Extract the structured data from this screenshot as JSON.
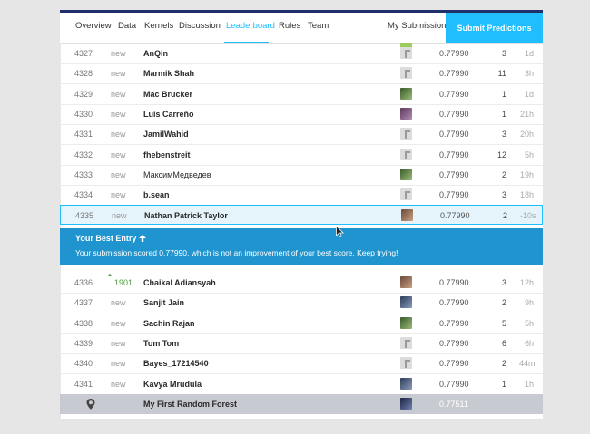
{
  "nav": {
    "tabs": [
      "Overview",
      "Data",
      "Kernels",
      "Discussion",
      "Leaderboard",
      "Rules",
      "Team"
    ],
    "my_submissions": "My Submissions",
    "submit": "Submit Predictions"
  },
  "rows_top": [
    {
      "rank": "4327",
      "change": "new",
      "team": "AnQin",
      "score": "0.77990",
      "entries": "3",
      "last": "1d",
      "avatar": "placeholder"
    },
    {
      "rank": "4328",
      "change": "new",
      "team": "Marmik Shah",
      "score": "0.77990",
      "entries": "11",
      "last": "3h",
      "avatar": "placeholder"
    },
    {
      "rank": "4329",
      "change": "new",
      "team": "Mac Brucker",
      "score": "0.77990",
      "entries": "1",
      "last": "1d",
      "avatar": "photo"
    },
    {
      "rank": "4330",
      "change": "new",
      "team": "Luis Carreño",
      "score": "0.77990",
      "entries": "1",
      "last": "21h",
      "avatar": "photo"
    },
    {
      "rank": "4331",
      "change": "new",
      "team": "JamilWahid",
      "score": "0.77990",
      "entries": "3",
      "last": "20h",
      "avatar": "placeholder"
    },
    {
      "rank": "4332",
      "change": "new",
      "team": "fhebenstreit",
      "score": "0.77990",
      "entries": "12",
      "last": "5h",
      "avatar": "placeholder"
    },
    {
      "rank": "4333",
      "change": "new",
      "team": "МаксимМедведев",
      "score": "0.77990",
      "entries": "2",
      "last": "19h",
      "avatar": "photo"
    },
    {
      "rank": "4334",
      "change": "new",
      "team": "b.sean",
      "score": "0.77990",
      "entries": "3",
      "last": "18h",
      "avatar": "placeholder"
    },
    {
      "rank": "4335",
      "change": "new",
      "team": "Nathan Patrick Taylor",
      "score": "0.77990",
      "entries": "2",
      "last": "-10s",
      "avatar": "photo"
    }
  ],
  "best_entry": {
    "title": "Your Best Entry",
    "message": "Your submission scored 0.77990, which is not an improvement of your best score. Keep trying!"
  },
  "rows_bottom": [
    {
      "rank": "4336",
      "change": "1901",
      "team": "Chaikal Adiansyah",
      "score": "0.77990",
      "entries": "3",
      "last": "12h",
      "avatar": "photo"
    },
    {
      "rank": "4337",
      "change": "new",
      "team": "Sanjit Jain",
      "score": "0.77990",
      "entries": "2",
      "last": "9h",
      "avatar": "photo"
    },
    {
      "rank": "4338",
      "change": "new",
      "team": "Sachin Rajan",
      "score": "0.77990",
      "entries": "5",
      "last": "5h",
      "avatar": "photo"
    },
    {
      "rank": "4339",
      "change": "new",
      "team": "Tom Tom",
      "score": "0.77990",
      "entries": "6",
      "last": "6h",
      "avatar": "placeholder"
    },
    {
      "rank": "4340",
      "change": "new",
      "team": "Bayes_17214540",
      "score": "0.77990",
      "entries": "2",
      "last": "44m",
      "avatar": "placeholder"
    },
    {
      "rank": "4341",
      "change": "new",
      "team": "Kavya Mrudula",
      "score": "0.77990",
      "entries": "1",
      "last": "1h",
      "avatar": "photo"
    }
  ],
  "my_entry": {
    "team": "My First Random Forest",
    "score": "0.77511"
  },
  "colors": {
    "accent": "#20beff",
    "best_box": "#1f94cf",
    "my_row": "#c7cbd1",
    "up": "#4a9a3a"
  }
}
